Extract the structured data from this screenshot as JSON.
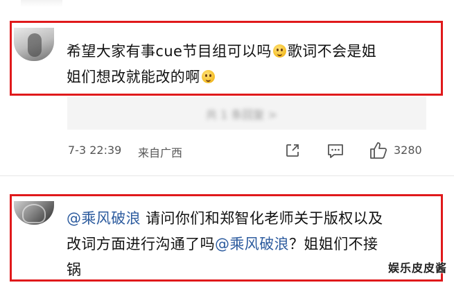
{
  "comments": [
    {
      "text_lines": [
        "希望大家有事cue节目组可以吗",
        "歌词不会是姐",
        "姐们想改就能改的啊"
      ],
      "emoji": "sad-pleading-emoji"
    },
    {
      "mention1": "@乘风破浪",
      "line1_rest": "请问你们和郑智化老师关于版权以及",
      "line2_start": "改词方面进行沟通了吗",
      "mention2": "@乘风破浪",
      "line2_end": "？姐姐们不接",
      "line3": "锅"
    }
  ],
  "reply_blurred_text": "共 1 条回复 >",
  "meta": {
    "timestamp": "7-3 22:39",
    "location": "来自广西",
    "like_count": "3280"
  },
  "watermark": "娱乐皮皮酱",
  "colors": {
    "highlight_border": "#e0191b",
    "mention": "#2c5b9e"
  }
}
